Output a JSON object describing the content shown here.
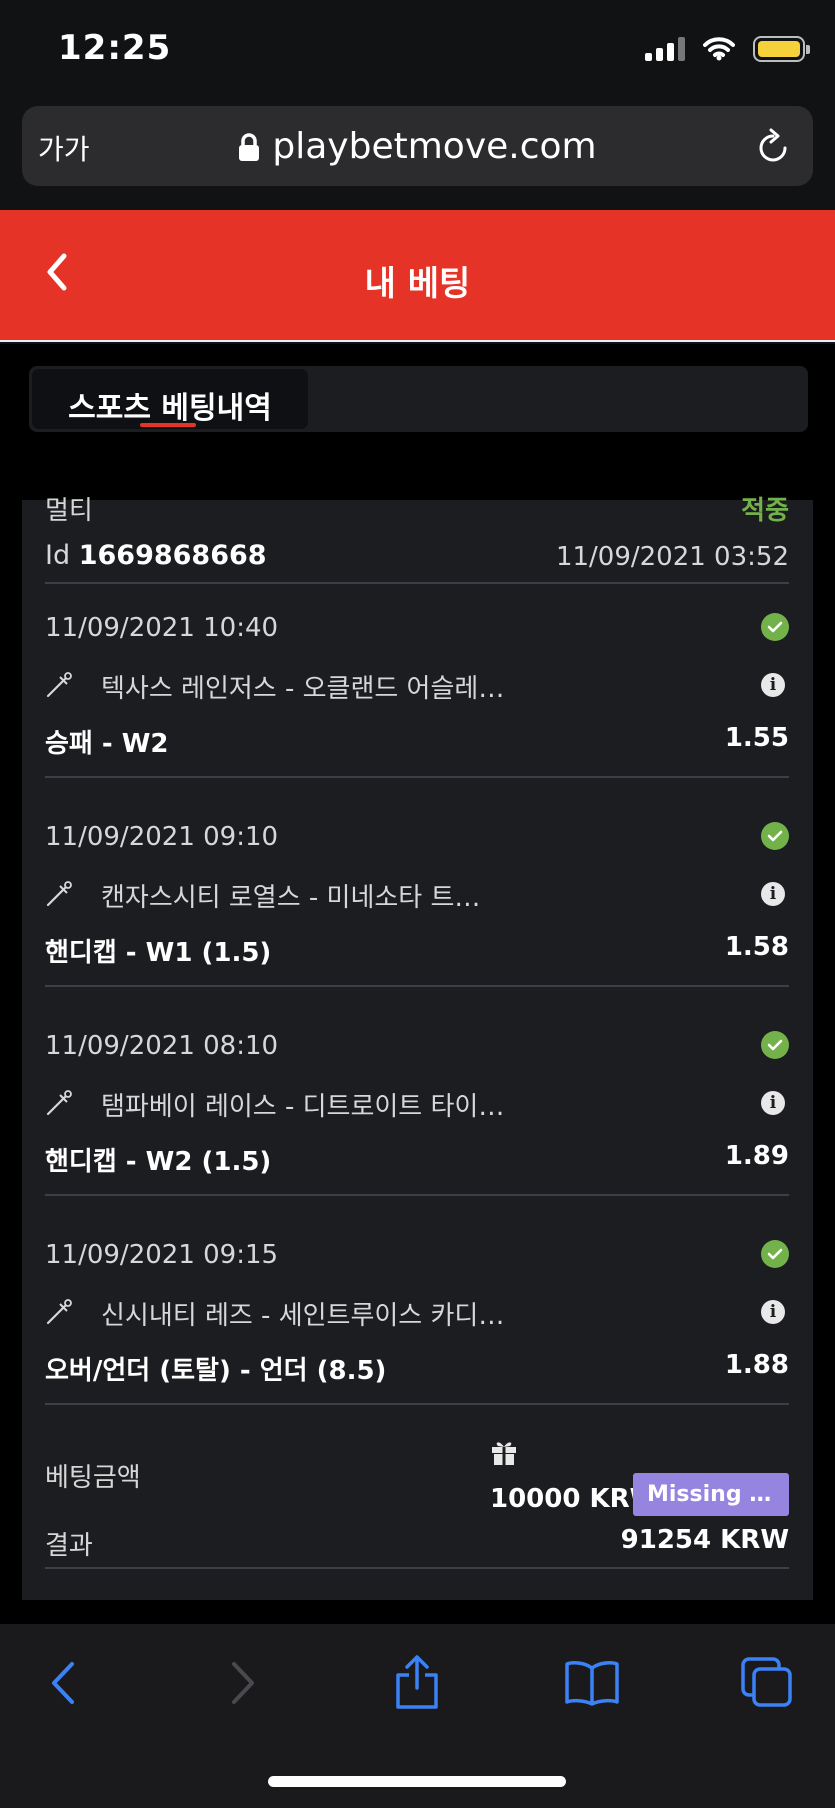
{
  "status_bar": {
    "time": "12:25"
  },
  "browser": {
    "text_size_label": "가가",
    "url": "playbetmove.com"
  },
  "header": {
    "title": "내 베팅"
  },
  "tabs": [
    {
      "label": "스포츠 베팅내역"
    }
  ],
  "bet": {
    "type_label": "멀티",
    "status": "적중",
    "id_prefix": "Id",
    "id_value": "1669868668",
    "placed_datetime": "11/09/2021 03:52",
    "events": [
      {
        "datetime": "11/09/2021 10:40",
        "teams": "텍사스 레인저스 - 오클랜드 어슬레…",
        "market": "승패 - W2",
        "odds": "1.55"
      },
      {
        "datetime": "11/09/2021 09:10",
        "teams": "캔자스시티 로열스 - 미네소타 트…",
        "market": "핸디캡 - W1 (1.5)",
        "odds": "1.58"
      },
      {
        "datetime": "11/09/2021 08:10",
        "teams": "탬파베이 레이스 - 디트로이트 타이…",
        "market": "핸디캡 - W2 (1.5)",
        "odds": "1.89"
      },
      {
        "datetime": "11/09/2021 09:15",
        "teams": "신시내티 레즈 - 세인트루이스 카디…",
        "market": "오버/언더 (토탈) - 언더 (8.5)",
        "odds": "1.88"
      }
    ],
    "stake_label": "베팅금액",
    "stake_value": "10000 KRW",
    "badge_label": "Missing tr…",
    "result_label": "결과",
    "result_value": "91254 KRW"
  },
  "colors": {
    "accent_red": "#e63327",
    "win_green": "#73b24a",
    "badge_purple": "#9685e0",
    "ios_blue": "#3b82f6"
  },
  "icons": [
    "back-chevron-icon",
    "lock-icon",
    "reload-icon",
    "baseball-bat-icon",
    "check-circle-icon",
    "info-icon",
    "gift-icon",
    "share-icon",
    "bookmarks-icon",
    "tabs-icon"
  ]
}
